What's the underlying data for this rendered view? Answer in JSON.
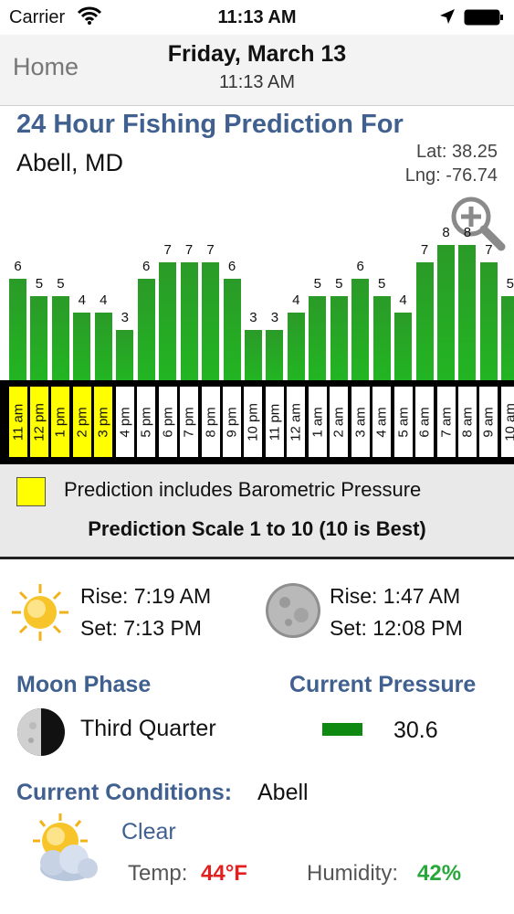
{
  "status": {
    "carrier": "Carrier",
    "time": "11:13 AM"
  },
  "nav": {
    "home_label": "Home",
    "date": "Friday, March 13",
    "time": "11:13 AM"
  },
  "prediction": {
    "title": "24 Hour Fishing Prediction For",
    "location": "Abell, MD",
    "lat_text": "Lat:  38.25",
    "lng_text": "Lng:  -76.74"
  },
  "chart_data": {
    "type": "bar",
    "categories": [
      "11 am",
      "12 pm",
      "1 pm",
      "2 pm",
      "3 pm",
      "4 pm",
      "5 pm",
      "6 pm",
      "7 pm",
      "8 pm",
      "9 pm",
      "10 pm",
      "11 pm",
      "12 am",
      "1 am",
      "2 am",
      "3 am",
      "4 am",
      "5 am",
      "6 am",
      "7 am",
      "8 am",
      "9 am",
      "10 am"
    ],
    "values": [
      6,
      5,
      5,
      4,
      4,
      3,
      6,
      7,
      7,
      7,
      6,
      3,
      3,
      4,
      5,
      5,
      6,
      5,
      4,
      7,
      8,
      8,
      7,
      5
    ],
    "barometric_included": [
      true,
      true,
      true,
      true,
      true,
      false,
      false,
      false,
      false,
      false,
      false,
      false,
      false,
      false,
      false,
      false,
      false,
      false,
      false,
      false,
      false,
      false,
      false,
      false
    ],
    "highlight_color": "#ffff00",
    "bar_color": "#22b522",
    "ylim": [
      0,
      10
    ]
  },
  "legend": {
    "barometric_text": "Prediction includes Barometric Pressure",
    "scale_text": "Prediction Scale 1 to 10    (10 is Best)"
  },
  "sun": {
    "rise": "Rise: 7:19 AM",
    "set": "Set: 7:13 PM"
  },
  "moon": {
    "rise": "Rise: 1:47 AM",
    "set": "Set: 12:08 PM"
  },
  "moon_phase": {
    "heading": "Moon Phase",
    "value": "Third Quarter"
  },
  "pressure": {
    "heading": "Current Pressure",
    "value": "30.6",
    "indicator_color": "#0e8a12"
  },
  "conditions": {
    "heading": "Current Conditions:",
    "location": "Abell",
    "summary": "Clear",
    "temp_label": "Temp:",
    "temp_value": "44°F",
    "humidity_label": "Humidity:",
    "humidity_value": "42%"
  },
  "icons": [
    "wifi-icon",
    "location-arrow-icon",
    "battery-icon",
    "zoom-in-icon",
    "sun-icon",
    "moon-icon",
    "moon-phase-icon",
    "partly-cloudy-icon"
  ]
}
